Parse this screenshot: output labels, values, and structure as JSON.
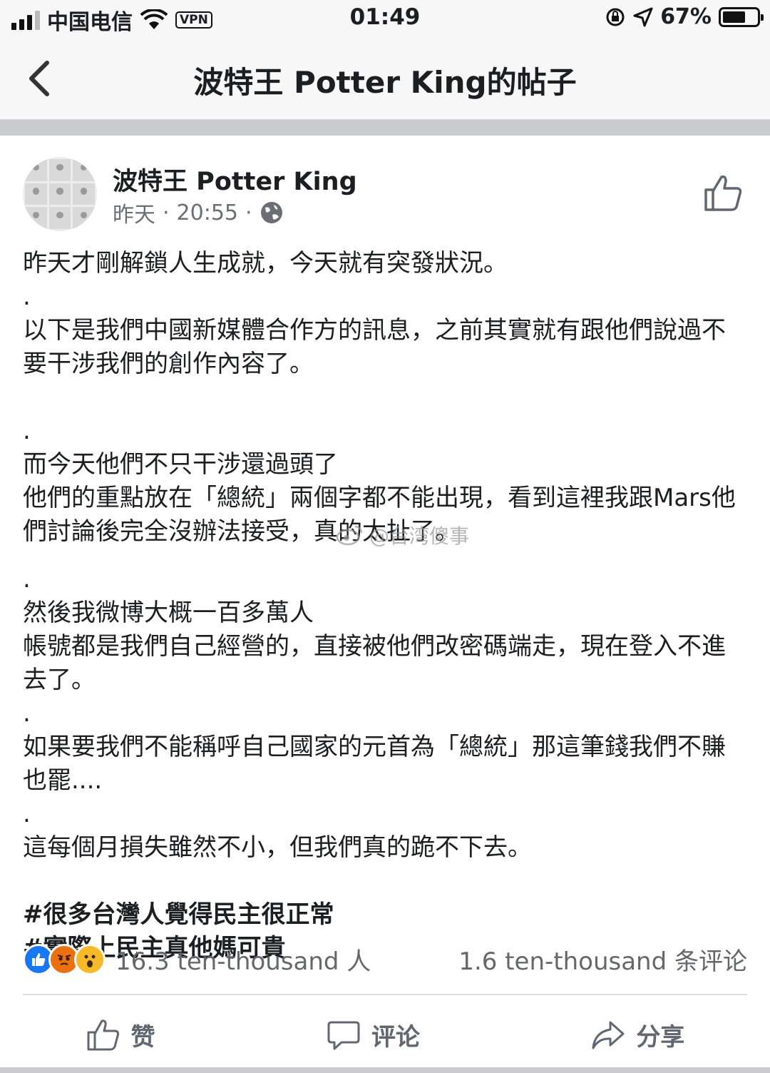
{
  "status_bar": {
    "carrier": "中国电信",
    "vpn": "VPN",
    "time": "01:49",
    "battery": "67%",
    "battery_level": 0.67
  },
  "nav": {
    "title": "波特王 Potter King的帖子"
  },
  "post": {
    "author": "波特王 Potter King",
    "date": "昨天",
    "time": "20:55",
    "separator": "·",
    "lines": [
      "昨天才剛解鎖人生成就，今天就有突發狀況。",
      ".",
      "以下是我們中國新媒體合作方的訊息，之前其實就有跟他們說過不要干涉我們的創作內容了。",
      ".",
      "而今天他們不只干涉還過頭了",
      "他們的重點放在「總統」兩個字都不能出現，看到這裡我跟Mars他們討論後完全沒辦法接受，真的太扯了。",
      ".",
      "然後我微博大概一百多萬人",
      "帳號都是我們自己經營的，直接被他們改密碼端走，現在登入不進去了。",
      ".",
      "如果要我們不能稱呼自己國家的元首為「總統」那這筆錢我們不賺也罷....",
      ".",
      "這每個月損失雖然不小，但我們真的跪不下去。"
    ],
    "hashtags": [
      "#很多台灣人覺得民主很正常",
      "#實際上民主真他媽可貴"
    ]
  },
  "watermark": "@台湾傻事",
  "stats": {
    "reactions_count": "16.3 ten-thousand 人",
    "comments_count": "1.6 ten-thousand 条评论"
  },
  "actions": {
    "like": "赞",
    "comment": "评论",
    "share": "分享"
  }
}
